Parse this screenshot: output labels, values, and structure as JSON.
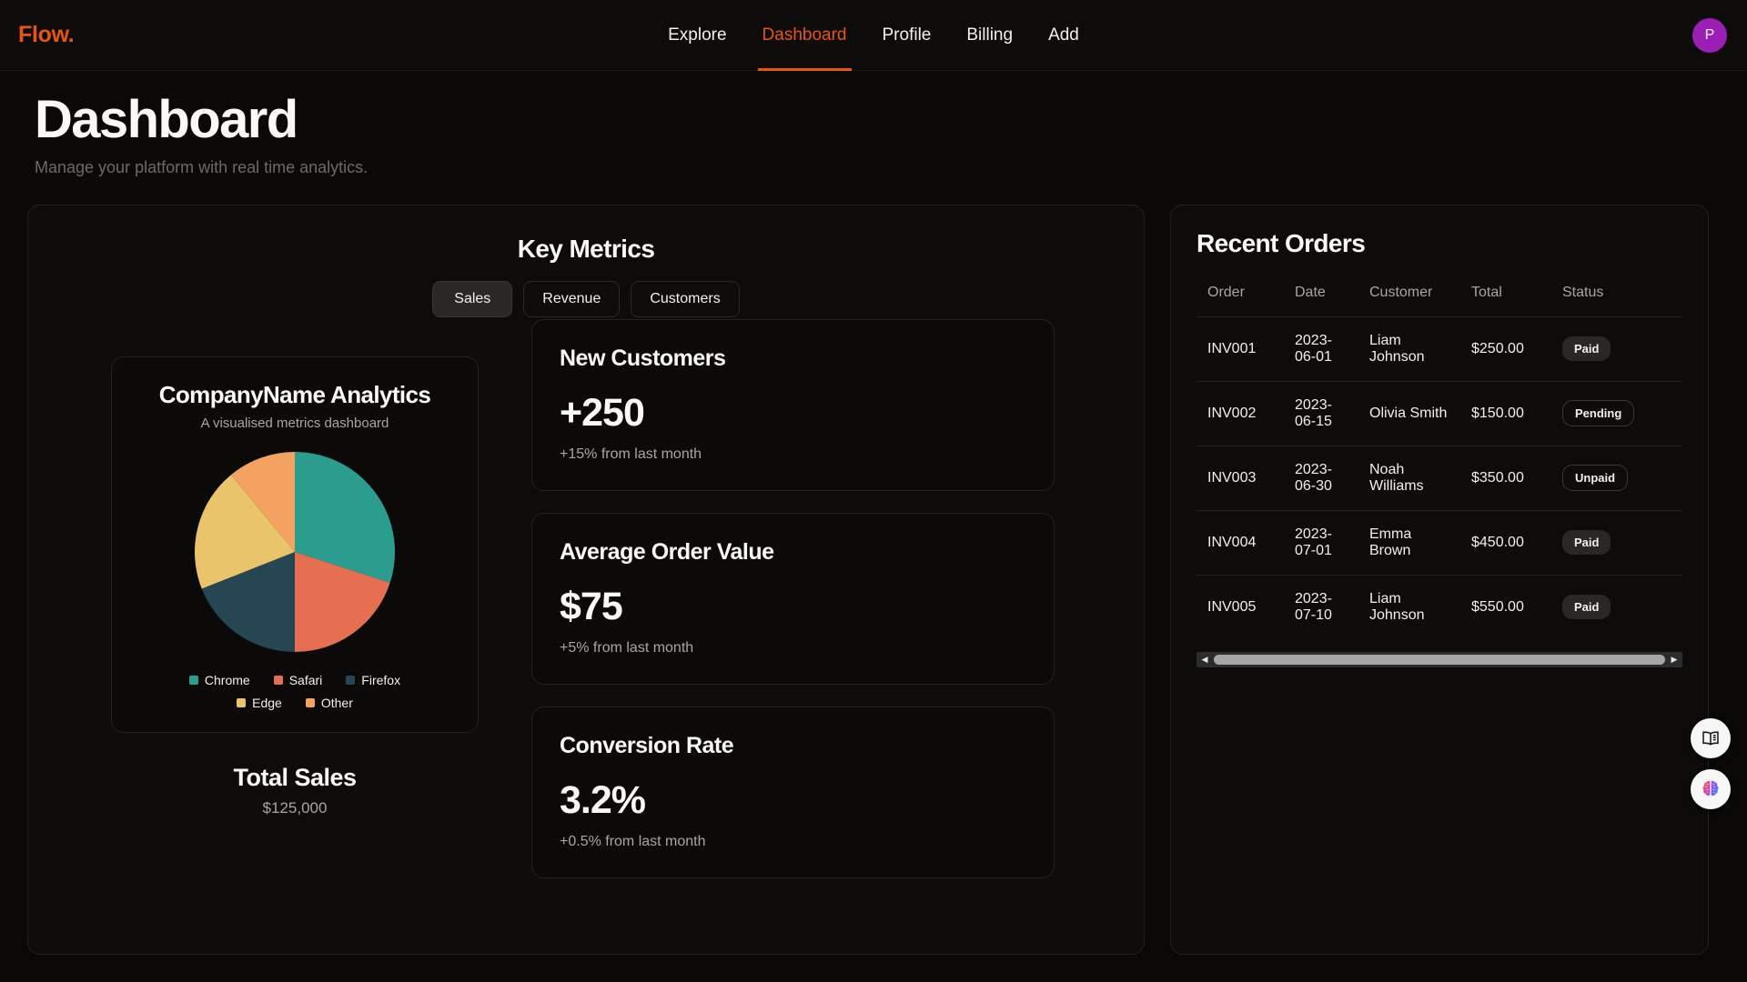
{
  "nav": {
    "brand": "Flow.",
    "links": [
      {
        "label": "Explore",
        "active": false
      },
      {
        "label": "Dashboard",
        "active": true
      },
      {
        "label": "Profile",
        "active": false
      },
      {
        "label": "Billing",
        "active": false
      },
      {
        "label": "Add",
        "active": false
      }
    ],
    "avatar_initial": "P",
    "avatar_color": "#9b1fb5",
    "accent_color": "#e8550f"
  },
  "page": {
    "title": "Dashboard",
    "subtitle": "Manage your platform with real time analytics."
  },
  "key_metrics": {
    "title": "Key Metrics",
    "tabs": [
      {
        "label": "Sales",
        "active": true
      },
      {
        "label": "Revenue",
        "active": false
      },
      {
        "label": "Customers",
        "active": false
      }
    ]
  },
  "analytics_card": {
    "title": "CompanyName Analytics",
    "subtitle": "A visualised metrics dashboard",
    "total_label": "Total Sales",
    "total_value": "$125,000"
  },
  "chart_data": {
    "type": "pie",
    "title": "CompanyName Analytics",
    "subtitle": "A visualised metrics dashboard",
    "categories": [
      "Chrome",
      "Safari",
      "Firefox",
      "Edge",
      "Other"
    ],
    "values": [
      30,
      20,
      19,
      20,
      11
    ],
    "colors": [
      "#2a9d8f",
      "#e76f51",
      "#264653",
      "#e9c46a",
      "#f4a261"
    ],
    "legend_position": "bottom",
    "legend_rows": [
      [
        "Chrome",
        "Safari",
        "Firefox"
      ],
      [
        "Edge",
        "Other"
      ]
    ],
    "start_angle_deg": 0,
    "direction": "clockwise",
    "grid": false,
    "total_label": "Total Sales",
    "total_value": "$125,000"
  },
  "metric_cards": [
    {
      "title": "New Customers",
      "value": "+250",
      "delta": "+15% from last month"
    },
    {
      "title": "Average Order Value",
      "value": "$75",
      "delta": "+5% from last month"
    },
    {
      "title": "Conversion Rate",
      "value": "3.2%",
      "delta": "+0.5% from last month"
    }
  ],
  "orders": {
    "title": "Recent Orders",
    "columns": [
      "Order",
      "Date",
      "Customer",
      "Total",
      "Status"
    ],
    "rows": [
      {
        "order": "INV001",
        "date": "2023-06-01",
        "customer": "Liam Johnson",
        "total": "$250.00",
        "status": "Paid",
        "status_style": "solid"
      },
      {
        "order": "INV002",
        "date": "2023-06-15",
        "customer": "Olivia Smith",
        "total": "$150.00",
        "status": "Pending",
        "status_style": "outline"
      },
      {
        "order": "INV003",
        "date": "2023-06-30",
        "customer": "Noah Williams",
        "total": "$350.00",
        "status": "Unpaid",
        "status_style": "outline"
      },
      {
        "order": "INV004",
        "date": "2023-07-01",
        "customer": "Emma Brown",
        "total": "$450.00",
        "status": "Paid",
        "status_style": "solid"
      },
      {
        "order": "INV005",
        "date": "2023-07-10",
        "customer": "Liam Johnson",
        "total": "$550.00",
        "status": "Paid",
        "status_style": "solid"
      }
    ],
    "scrollbar": {
      "left_arrow": "◀",
      "right_arrow": "▶"
    }
  },
  "floating_buttons": [
    {
      "name": "docs-book-icon"
    },
    {
      "name": "ai-brain-icon"
    }
  ]
}
